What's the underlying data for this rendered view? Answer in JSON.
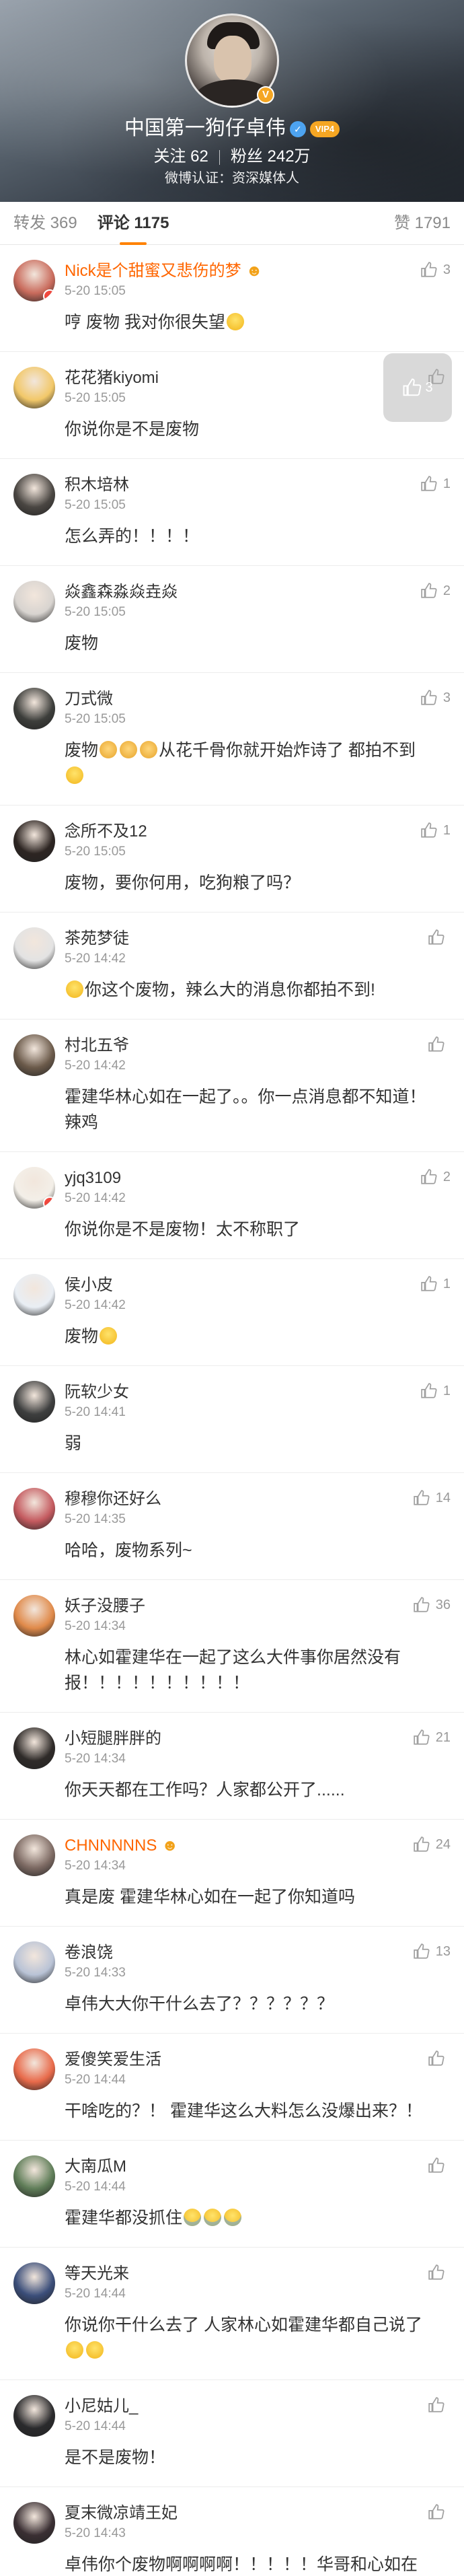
{
  "profile": {
    "username": "中国第一狗仔卓伟",
    "vip_label": "VIP4",
    "following_label": "关注",
    "following_count": "62",
    "followers_label": "粉丝",
    "followers_count": "242万",
    "certification": "微博认证：资深媒体人"
  },
  "tabs": {
    "reposts": "转发 369",
    "comments": "评论 1175",
    "likes": "赞 1791"
  },
  "floating_like_count": "3",
  "comments": [
    {
      "name": "Nick是个甜蜜又悲伤的梦",
      "name_suffix": "☻",
      "time": "5-20 15:05",
      "text": "哼 废物 我对你很失望",
      "likes": "3",
      "avatar": "#c96b5c"
    },
    {
      "name": "花花猪kiyomi",
      "time": "5-20 15:05",
      "text": "你说你是不是废物",
      "likes": "",
      "avatar": "#f2c869"
    },
    {
      "name": "积木培林",
      "time": "5-20 15:05",
      "text": "怎么弄的！！！！",
      "likes": "1",
      "avatar": "#4a4642"
    },
    {
      "name": "焱鑫森淼焱垚焱",
      "time": "5-20 15:05",
      "text": "废物",
      "likes": "2",
      "avatar": "#d8d4d0"
    },
    {
      "name": "刀式微",
      "time": "5-20 15:05",
      "text": "废物",
      "text_tail": "从花千骨你就开始炸诗了 都拍不到",
      "likes": "3",
      "avatar": "#3d3e3b"
    },
    {
      "name": "念所不及12",
      "time": "5-20 15:05",
      "text": "废物，要你何用，吃狗粮了吗？",
      "likes": "1",
      "avatar": "#2d2522"
    },
    {
      "name": "茶苑梦徒",
      "time": "5-20 14:42",
      "text": "你这个废物，辣么大的消息你都拍不到!",
      "likes": "",
      "avatar": "#e3e3e3"
    },
    {
      "name": "村北五爷",
      "time": "5-20 14:42",
      "text": "霍建华林心如在一起了。。你一点消息都不知道！辣鸡",
      "likes": "",
      "avatar": "#6b5a4a"
    },
    {
      "name": "yjq3109",
      "time": "5-20 14:42",
      "text": "你说你是不是废物！太不称职了",
      "likes": "2",
      "avatar": "#f3efe8"
    },
    {
      "name": "侯小皮",
      "time": "5-20 14:42",
      "text": "废物",
      "likes": "1",
      "avatar": "#e9eef4"
    },
    {
      "name": "阮软少女",
      "time": "5-20 14:41",
      "text": "弱",
      "likes": "1",
      "avatar": "#3e3f3f"
    },
    {
      "name": "穆穆你还好么",
      "time": "5-20 14:35",
      "text": "哈哈，废物系列~",
      "likes": "14",
      "avatar": "#c45a5f"
    },
    {
      "name": "妖子没腰子",
      "time": "5-20 14:34",
      "text": "林心如霍建华在一起了这么大件事你居然没有报！！！！！！！！！！",
      "likes": "36",
      "avatar": "#e08a4a"
    },
    {
      "name": "小短腿胖胖的",
      "time": "5-20 14:34",
      "text": "你天天都在工作吗？人家都公开了......",
      "likes": "21",
      "avatar": "#2f2b29"
    },
    {
      "name": "CHNNNNNS",
      "name_suffix": "☻",
      "time": "5-20 14:34",
      "text": "真是废 霍建华林心如在一起了你知道吗",
      "likes": "24",
      "avatar": "#7d6a63"
    },
    {
      "name": "卷浪饶",
      "time": "5-20 14:33",
      "text": "卓伟大大你干什么去了？？？？？？",
      "likes": "13",
      "avatar": "#b9c3d6"
    },
    {
      "name": "爱傻笑爱生活",
      "time": "5-20 14:44",
      "text": "干啥吃的？！ 霍建华这么大料怎么没爆出来？！",
      "likes": "",
      "avatar": "#e86a4a"
    },
    {
      "name": "大南瓜M",
      "time": "5-20 14:44",
      "text": "霍建华都没抓住",
      "likes": "",
      "avatar": "#5f7d58"
    },
    {
      "name": "等天光来",
      "time": "5-20 14:44",
      "text": "你说你干什么去了 人家林心如霍建华都自己说了",
      "likes": "",
      "avatar": "#3b4e7a"
    },
    {
      "name": "小尼姑儿_",
      "time": "5-20 14:44",
      "text": "是不是废物！",
      "likes": "",
      "avatar": "#2a2a2c"
    },
    {
      "name": "夏末微凉靖王妃",
      "time": "5-20 14:43",
      "text": "卓伟你个废物啊啊啊啊！！！！！华哥和心如在一起了这么大个料你居然一点也没拍到？？？？卓伟你蝴到地心了",
      "likes": "",
      "avatar": "#3a2f33"
    }
  ]
}
